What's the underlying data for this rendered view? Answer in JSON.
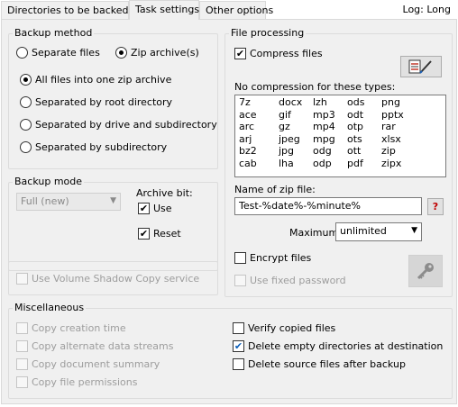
{
  "tabs": [
    {
      "label": "Directories to be backed up"
    },
    {
      "label": "Task settings"
    },
    {
      "label": "Other options"
    }
  ],
  "log_label": "Log: Long",
  "backup_method": {
    "title": "Backup method",
    "separate_files": "Separate files",
    "zip_archives": "Zip archive(s)",
    "all_files_one_zip": "All files into one zip archive",
    "separated_root": "Separated by root directory",
    "separated_drive": "Separated by drive and subdirectory",
    "separated_subdir": "Separated by subdirectory"
  },
  "backup_mode": {
    "title": "Backup mode",
    "mode_value": "Full (new)",
    "archive_bit_label": "Archive bit:",
    "use_label": "Use",
    "reset_label": "Reset"
  },
  "vss_label": "Use Volume Shadow Copy service",
  "file_processing": {
    "title": "File processing",
    "compress_label": "Compress files",
    "no_compression_label": "No compression for these types:",
    "extensions": [
      [
        "7z",
        "docx",
        "lzh",
        "ods",
        "png"
      ],
      [
        "ace",
        "gif",
        "mp3",
        "odt",
        "pptx"
      ],
      [
        "arc",
        "gz",
        "mp4",
        "otp",
        "rar"
      ],
      [
        "arj",
        "jpeg",
        "mpg",
        "ots",
        "xlsx"
      ],
      [
        "bz2",
        "jpg",
        "odg",
        "ott",
        "zip"
      ],
      [
        "cab",
        "lha",
        "odp",
        "pdf",
        "zipx"
      ]
    ],
    "zip_name_label": "Name of zip file:",
    "zip_name_value": "Test-%date%-%minute%",
    "help_label": "?",
    "max_size_label": "Maximum size:",
    "max_size_value": "unlimited",
    "encrypt_label": "Encrypt files",
    "fixed_password_label": "Use fixed password"
  },
  "misc": {
    "title": "Miscellaneous",
    "copy_creation_time": "Copy creation time",
    "copy_ads": "Copy alternate data streams",
    "copy_doc_summary": "Copy document summary",
    "copy_permissions": "Copy file permissions",
    "verify": "Verify copied files",
    "delete_empty": "Delete empty directories at destination",
    "delete_source": "Delete source files after backup"
  },
  "check_glyph": "✔",
  "icons": {
    "edit_list": "edit-list-icon",
    "key": "key-icon"
  }
}
